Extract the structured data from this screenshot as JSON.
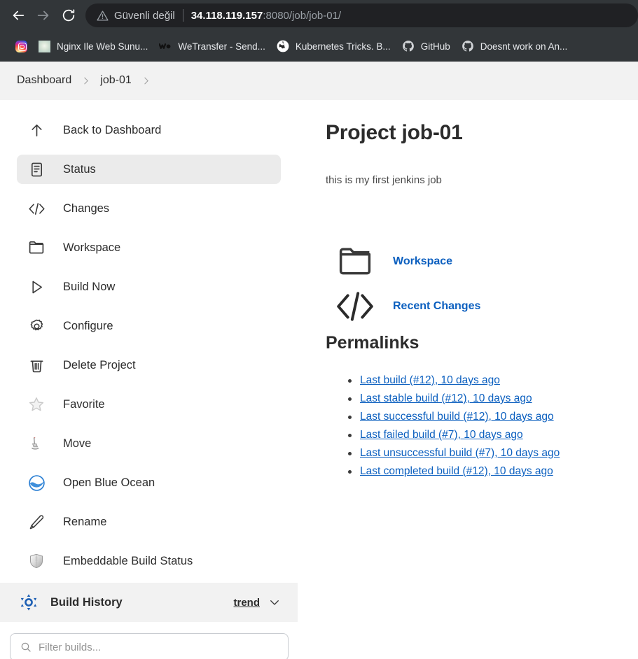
{
  "browser": {
    "back_icon": "back-arrow-icon",
    "forward_icon": "forward-arrow-icon",
    "reload_icon": "reload-icon",
    "security_warning_icon": "warning-triangle-icon",
    "security_label": "Güvenli değil",
    "url_host": "34.118.119.157",
    "url_path": ":8080/job/job-01/",
    "bookmarks": [
      {
        "label": "",
        "icon": "instagram-icon"
      },
      {
        "label": "Nginx Ile Web Sunu...",
        "icon": "nginx-site-icon"
      },
      {
        "label": "WeTransfer - Send...",
        "icon": "wetransfer-icon"
      },
      {
        "label": "Kubernetes Tricks. B...",
        "icon": "globe-icon"
      },
      {
        "label": "GitHub",
        "icon": "github-icon"
      },
      {
        "label": "Doesnt work on An...",
        "icon": "github-icon"
      }
    ]
  },
  "breadcrumb": {
    "items": [
      "Dashboard",
      "job-01"
    ],
    "separator_icon": "chevron-right-icon"
  },
  "sidebar": {
    "items": [
      {
        "label": "Back to Dashboard",
        "icon": "arrow-up-icon",
        "active": false
      },
      {
        "label": "Status",
        "icon": "document-status-icon",
        "active": true
      },
      {
        "label": "Changes",
        "icon": "code-brackets-icon",
        "active": false
      },
      {
        "label": "Workspace",
        "icon": "folder-icon",
        "active": false
      },
      {
        "label": "Build Now",
        "icon": "play-triangle-icon",
        "active": false
      },
      {
        "label": "Configure",
        "icon": "gear-icon",
        "active": false
      },
      {
        "label": "Delete Project",
        "icon": "trash-icon",
        "active": false
      },
      {
        "label": "Favorite",
        "icon": "star-outline-icon",
        "active": false
      },
      {
        "label": "Move",
        "icon": "move-flag-icon",
        "active": false
      },
      {
        "label": "Open Blue Ocean",
        "icon": "blue-ocean-icon",
        "active": false
      },
      {
        "label": "Rename",
        "icon": "pencil-icon",
        "active": false
      },
      {
        "label": "Embeddable Build Status",
        "icon": "shield-icon",
        "active": false
      }
    ],
    "build_history": {
      "title": "Build History",
      "icon": "jenkins-weather-icon",
      "trend_label": "trend",
      "chevron_icon": "chevron-down-icon",
      "filter_placeholder": "Filter builds...",
      "filter_icon": "search-icon",
      "filter_value": ""
    }
  },
  "main": {
    "title": "Project job-01",
    "description": "this is my first jenkins job",
    "links": [
      {
        "label": "Workspace",
        "icon": "folder-icon"
      },
      {
        "label": "Recent Changes",
        "icon": "code-brackets-icon"
      }
    ],
    "permalinks_heading": "Permalinks",
    "permalinks": [
      "Last build (#12), 10 days ago",
      "Last stable build (#12), 10 days ago",
      "Last successful build (#12), 10 days ago",
      "Last failed build (#7), 10 days ago",
      "Last unsuccessful build (#7), 10 days ago",
      "Last completed build (#12), 10 days ago"
    ]
  },
  "colors": {
    "chrome_bg": "#323639",
    "omnibox_bg": "#202124",
    "link_blue": "#0b5fbf",
    "breadcrumb_bg": "#f2f2f2",
    "active_item_bg": "#ebebeb"
  }
}
